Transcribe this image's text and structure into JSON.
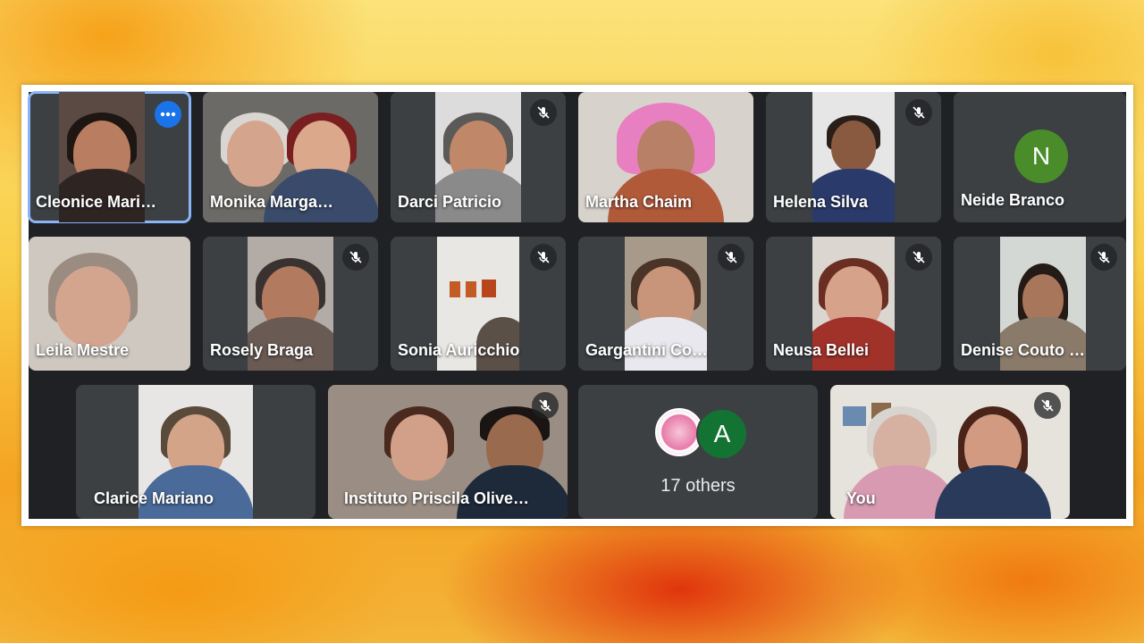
{
  "participants": [
    {
      "name": "Cleonice Mari…",
      "muted": false,
      "more_options": true
    },
    {
      "name": "Monika Marga…",
      "muted": false
    },
    {
      "name": "Darci Patricio",
      "muted": true
    },
    {
      "name": "Martha Chaim",
      "muted": false
    },
    {
      "name": "Helena Silva",
      "muted": true
    },
    {
      "name": "Neide Branco",
      "avatar_letter": "N",
      "avatar_color": "#4a8c2a"
    },
    {
      "name": "Leila Mestre",
      "muted": false
    },
    {
      "name": "Rosely Braga",
      "muted": true
    },
    {
      "name": "Sonia Auricchio",
      "muted": true
    },
    {
      "name": "Gargantini Co…",
      "muted": true
    },
    {
      "name": "Neusa Bellei",
      "muted": true
    },
    {
      "name": "Denise Couto …",
      "muted": true
    },
    {
      "name": "Clarice Mariano",
      "muted": false
    },
    {
      "name": "Instituto Priscila Olive…",
      "muted": true
    },
    {
      "name": "You",
      "muted": true
    }
  ],
  "others": {
    "label": "17 others",
    "avatar_letter": "A",
    "avatar_color": "#137333"
  },
  "icons": {
    "mic_off": "mic-off-icon",
    "more": "more-options-icon"
  },
  "colors": {
    "meet_bg": "#202124",
    "tile_bg": "#3c4043",
    "accent": "#1a73e8"
  }
}
